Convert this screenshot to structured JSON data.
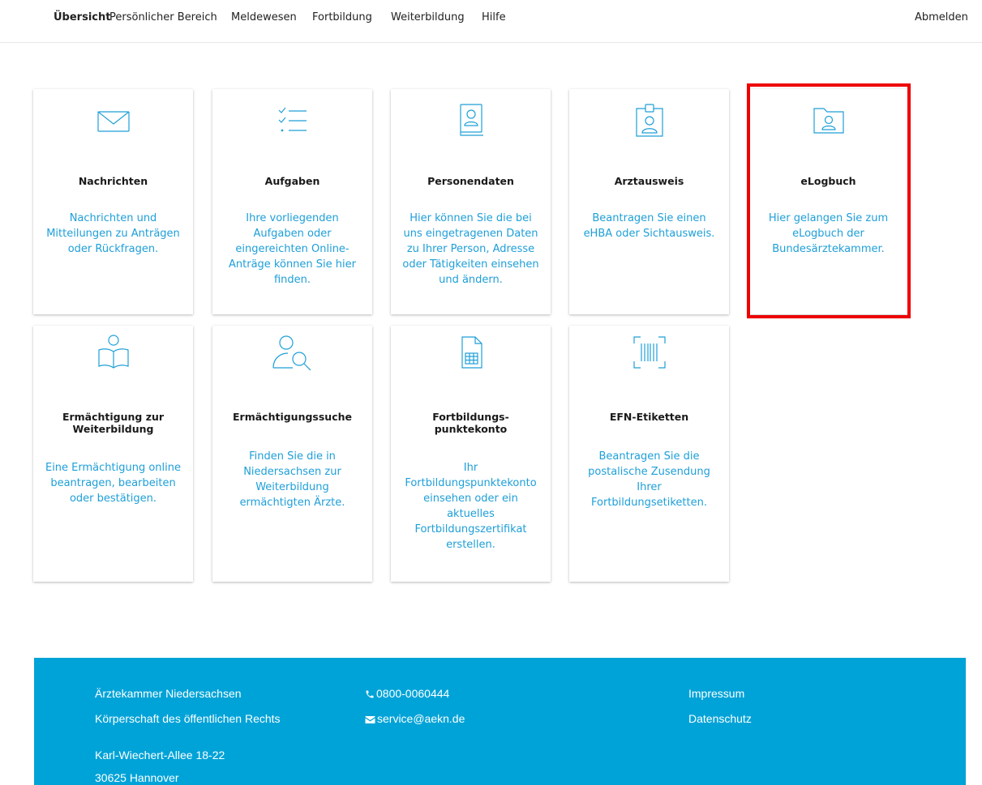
{
  "nav": {
    "items": [
      {
        "label": "Übersicht"
      },
      {
        "label": "Persönlicher Bereich"
      },
      {
        "label": "Meldewesen"
      },
      {
        "label": "Fortbildung"
      },
      {
        "label": "Weiterbildung"
      },
      {
        "label": "Hilfe"
      }
    ],
    "logout": "Abmelden"
  },
  "tiles": [
    {
      "icon": "envelope-icon",
      "title": "Nachrichten",
      "description": "Nachrichten und Mitteilungen zu Anträgen oder Rückfragen."
    },
    {
      "icon": "checklist-icon",
      "title": "Aufgaben",
      "description": "Ihre vorliegenden Aufgaben oder eingereichten Online-Anträge können Sie hier finden."
    },
    {
      "icon": "address-book-icon",
      "title": "Personendaten",
      "description": "Hier können Sie die bei uns eingetragenen Daten zu Ihrer Person, Adresse oder Tätigkeiten einsehen und ändern."
    },
    {
      "icon": "id-badge-icon",
      "title": "Arztausweis",
      "description": "Beantragen Sie einen eHBA oder Sichtausweis."
    },
    {
      "icon": "folder-user-icon",
      "title": "eLogbuch",
      "description": "Hier gelangen Sie zum eLogbuch der Bundesärztekammer."
    },
    {
      "icon": "reading-person-icon",
      "title": "Ermächtigung zur Weiterbildung",
      "description": "Eine Ermächtigung online beantragen, bearbeiten oder bestätigen."
    },
    {
      "icon": "person-search-icon",
      "title": "Ermächtigungssuche",
      "description": "Finden Sie die in Niedersachsen zur Weiterbildung ermächtigten Ärzte."
    },
    {
      "icon": "calculator-document-icon",
      "title": "Fortbildungs- punktekonto",
      "description": "Ihr Fortbildungspunktekonto einsehen oder ein aktuelles Fortbildungszertifikat erstellen."
    },
    {
      "icon": "barcode-scan-icon",
      "title": "EFN-Etiketten",
      "description": "Beantragen Sie die postalische Zusendung Ihrer Fortbildungsetiketten."
    }
  ],
  "footer": {
    "org_name": "Ärztekammer Niedersachsen",
    "org_type": "Körperschaft des öffentlichen Rechts",
    "street": "Karl-Wiechert-Allee 18-22",
    "city": "30625 Hannover",
    "phone": "0800-0060444",
    "email": "service@aekn.de",
    "impressum": "Impressum",
    "datenschutz": "Datenschutz"
  },
  "colors": {
    "accent": "#1e9fd8",
    "footer_bg": "#00a3d8",
    "highlight": "#ee0000"
  }
}
